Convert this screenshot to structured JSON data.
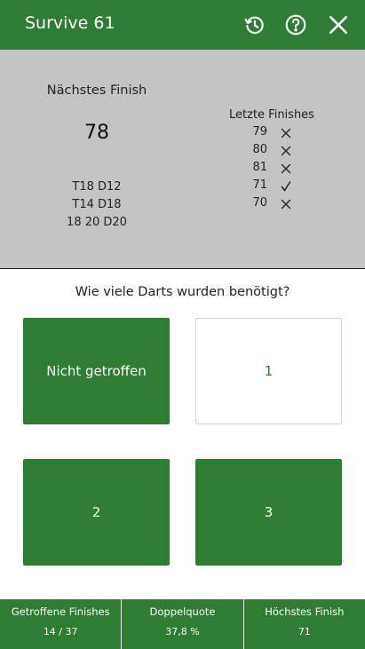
{
  "header": {
    "title": "Survive 61",
    "icons": [
      "history-icon",
      "help-icon",
      "close-icon"
    ]
  },
  "next_finish": {
    "label": "Nächstes Finish",
    "value": "78",
    "routes": [
      "T18 D12",
      "T14 D18",
      "18 20 D20"
    ]
  },
  "last_finishes": {
    "label": "Letzte Finishes",
    "items": [
      {
        "value": "79",
        "result": "miss"
      },
      {
        "value": "80",
        "result": "miss"
      },
      {
        "value": "81",
        "result": "miss"
      },
      {
        "value": "71",
        "result": "hit"
      },
      {
        "value": "70",
        "result": "miss"
      }
    ]
  },
  "question": "Wie viele Darts wurden benötigt?",
  "answers": {
    "miss": "Nicht getroffen",
    "one": "1",
    "two": "2",
    "three": "3"
  },
  "stats": [
    {
      "label": "Getroffene Finishes",
      "value": "14 / 37"
    },
    {
      "label": "Doppelquote",
      "value": "37,8 %"
    },
    {
      "label": "Höchstes Finish",
      "value": "71"
    }
  ],
  "colors": {
    "primary": "#2e7d32",
    "info_background": "#c4c4c4",
    "text": "#222222"
  }
}
